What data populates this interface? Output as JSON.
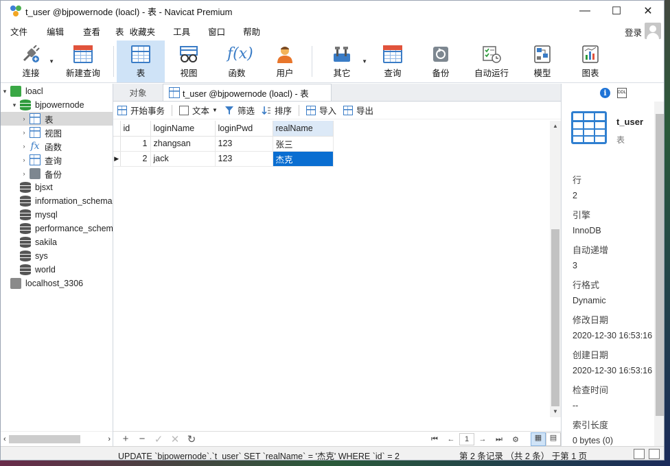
{
  "window": {
    "title": "t_user @bjpowernode (loacl) - 表 - Navicat Premium",
    "controls": {
      "minimize": "—",
      "maximize": "☐",
      "close": "✕"
    }
  },
  "menu": {
    "items": [
      "文件",
      "编辑",
      "查看",
      "表",
      "收藏夹",
      "工具",
      "窗口",
      "帮助"
    ],
    "login": "登录"
  },
  "toolbar": {
    "connect": "连接",
    "new_query": "新建查询",
    "table": "表",
    "view": "视图",
    "function": "函数",
    "user": "用户",
    "other": "其它",
    "query": "查询",
    "backup": "备份",
    "automation": "自动运行",
    "model": "模型",
    "chart": "图表"
  },
  "sidebar": {
    "connection": "loacl",
    "database": "bjpowernode",
    "children": [
      "表",
      "视图",
      "函数",
      "查询",
      "备份"
    ],
    "databases": [
      "bjsxt",
      "information_schema",
      "mysql",
      "performance_schema",
      "sakila",
      "sys",
      "world"
    ],
    "connection2": "localhost_3306"
  },
  "tabs": {
    "objects": "对象",
    "active": "t_user @bjpowernode (loacl) - 表"
  },
  "actions": {
    "begin_transaction": "开始事务",
    "text": "文本",
    "filter": "筛选",
    "sort": "排序",
    "import": "导入",
    "export": "导出"
  },
  "table": {
    "columns": [
      "id",
      "loginName",
      "loginPwd",
      "realName"
    ],
    "rows": [
      {
        "id": "1",
        "loginName": "zhangsan",
        "loginPwd": "123",
        "realName": "张三"
      },
      {
        "id": "2",
        "loginName": "jack",
        "loginPwd": "123",
        "realName": "杰克"
      }
    ],
    "current_row": 2,
    "selected_cell": "realName"
  },
  "bottom": {
    "add": "+",
    "remove": "−",
    "apply": "✓",
    "cancel": "✕",
    "refresh": "↻",
    "page": "1"
  },
  "status": {
    "sql": "UPDATE `bjpowernode`.`t_user` SET `realName` = '杰克' WHERE `id` = 2",
    "records": "第 2 条记录 （共 2 条） 于第 1 页"
  },
  "info_panel": {
    "name": "t_user",
    "type": "表",
    "properties": [
      {
        "key": "行",
        "value": "2"
      },
      {
        "key": "引擎",
        "value": "InnoDB"
      },
      {
        "key": "自动递增",
        "value": "3"
      },
      {
        "key": "行格式",
        "value": "Dynamic"
      },
      {
        "key": "修改日期",
        "value": "2020-12-30 16:53:16"
      },
      {
        "key": "创建日期",
        "value": "2020-12-30 16:53:16"
      },
      {
        "key": "检查时间",
        "value": "--"
      },
      {
        "key": "索引长度",
        "value": "0 bytes (0)"
      }
    ]
  },
  "colors": {
    "accent": "#3a7cc6",
    "selection": "#0a6ed1",
    "toolbar_active": "#cfe3f7"
  }
}
